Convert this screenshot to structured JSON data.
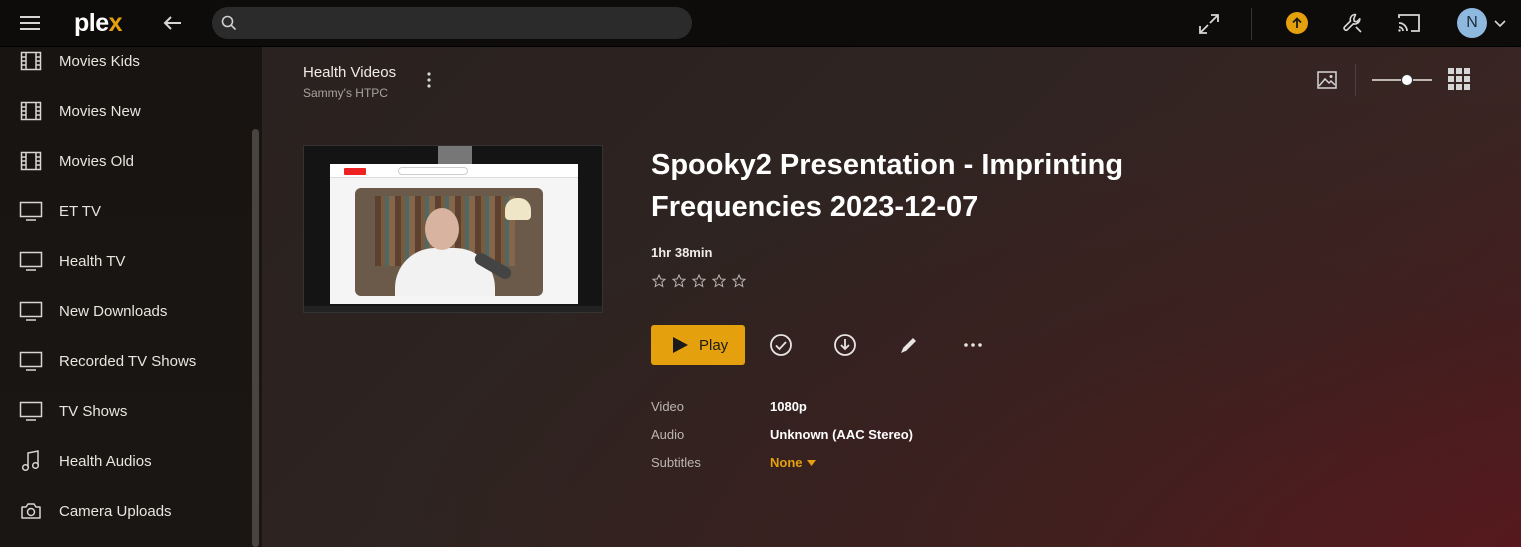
{
  "app": {
    "logo_text": "ple",
    "logo_x": "x",
    "accent_color": "#e5a00d"
  },
  "topbar": {
    "search_placeholder": "",
    "user_initial": "N"
  },
  "sidebar": {
    "items": [
      {
        "label": "Movies Kids",
        "icon": "film-icon"
      },
      {
        "label": "Movies New",
        "icon": "film-icon"
      },
      {
        "label": "Movies Old",
        "icon": "film-icon"
      },
      {
        "label": "ET TV",
        "icon": "tv-icon"
      },
      {
        "label": "Health TV",
        "icon": "tv-icon"
      },
      {
        "label": "New Downloads",
        "icon": "tv-icon"
      },
      {
        "label": "Recorded TV Shows",
        "icon": "tv-icon"
      },
      {
        "label": "TV Shows",
        "icon": "tv-icon"
      },
      {
        "label": "Health Audios",
        "icon": "music-note-icon"
      },
      {
        "label": "Camera Uploads",
        "icon": "camera-icon"
      }
    ]
  },
  "header": {
    "library_title": "Health Videos",
    "server_name": "Sammy's HTPC",
    "zoom_level": 0.6
  },
  "item": {
    "title": "Spooky2 Presentation - Imprinting Frequencies 2023-12-07",
    "duration": "1hr 38min",
    "rating_stars": 0,
    "rating_max": 5,
    "play_label": "Play"
  },
  "details": {
    "video_label": "Video",
    "video_value": "1080p",
    "audio_label": "Audio",
    "audio_value": "Unknown (AAC Stereo)",
    "subtitles_label": "Subtitles",
    "subtitles_value": "None"
  }
}
